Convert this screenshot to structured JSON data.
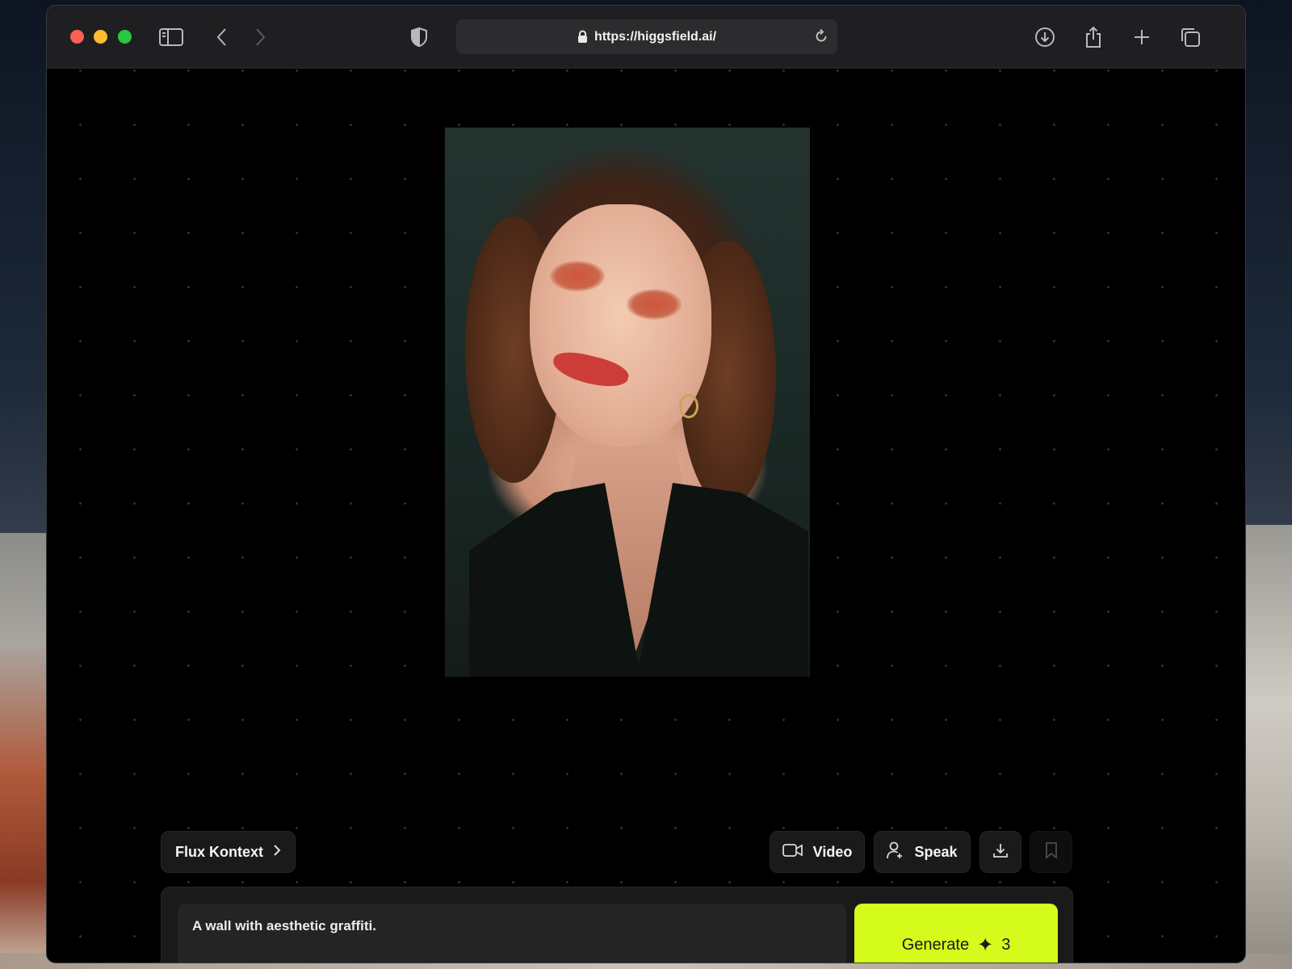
{
  "browser": {
    "url": "https://higgsfield.ai/"
  },
  "toolbar": {
    "model_label": "Flux Kontext",
    "video_label": "Video",
    "speak_label": "Speak"
  },
  "prompt": {
    "text": "A wall with aesthetic graffiti."
  },
  "generate": {
    "label": "Generate",
    "credits": "3"
  },
  "colors": {
    "accent": "#d4fb1b",
    "panel": "#1a1a1a",
    "background": "#000000"
  }
}
